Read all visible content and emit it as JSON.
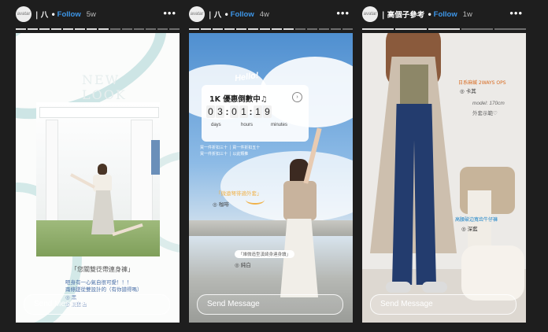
{
  "stories": [
    {
      "avatar_text": "avatar",
      "username": "| 八 •",
      "follow_label": "Follow",
      "time": "5w",
      "more": "•••",
      "overlay": {
        "caption_title": "「您關雙徔帶連身褲」",
        "caption_line1": "咂身有一心氣自很可愛！！！",
        "caption_line2": "兩條蹉從雙設計的（有你譜得嗎）",
        "color_line1": "◎ 黑",
        "color_line2": "◎ 淡藍色"
      },
      "send_placeholder": "Send Message"
    },
    {
      "avatar_text": "avatar",
      "username": "| 八 •",
      "follow_label": "Follow",
      "time": "4w",
      "more": "•••",
      "overlay": {
        "hello": "Hello!",
        "countdown_title": "1K 優惠倒數中♫",
        "digits": [
          "0",
          "3",
          "0",
          "1",
          "1",
          "9"
        ],
        "label_days": "days",
        "label_hours": "hours",
        "label_minutes": "minutes",
        "promo1": "買一件折扣三十 │ 買一件折扣五十",
        "promo2": "買一件折扣三十 │ 以此類推",
        "tag_name": "「微遠弩徘適外套」",
        "tag_color": "◎ 咖啡",
        "tag2_name": "「維微造型漢綺身連身讀」",
        "tag2_color": "◎ 純白"
      },
      "send_placeholder": "Send Message"
    },
    {
      "avatar_text": "avatar",
      "username": "| 高個子參考 •",
      "follow_label": "Follow",
      "time": "1w",
      "more": "•••",
      "overlay": {
        "item1_name": "日系麻縅 2WAYS OPS",
        "item1_color": "◎ 卡其",
        "model_line1": "model: 170cm",
        "model_line2": "外套示範♡",
        "item2_name": "高腰破边寬齿牛仔褲",
        "item2_color": "◎ 深藍"
      },
      "send_placeholder": "Send Message"
    }
  ]
}
